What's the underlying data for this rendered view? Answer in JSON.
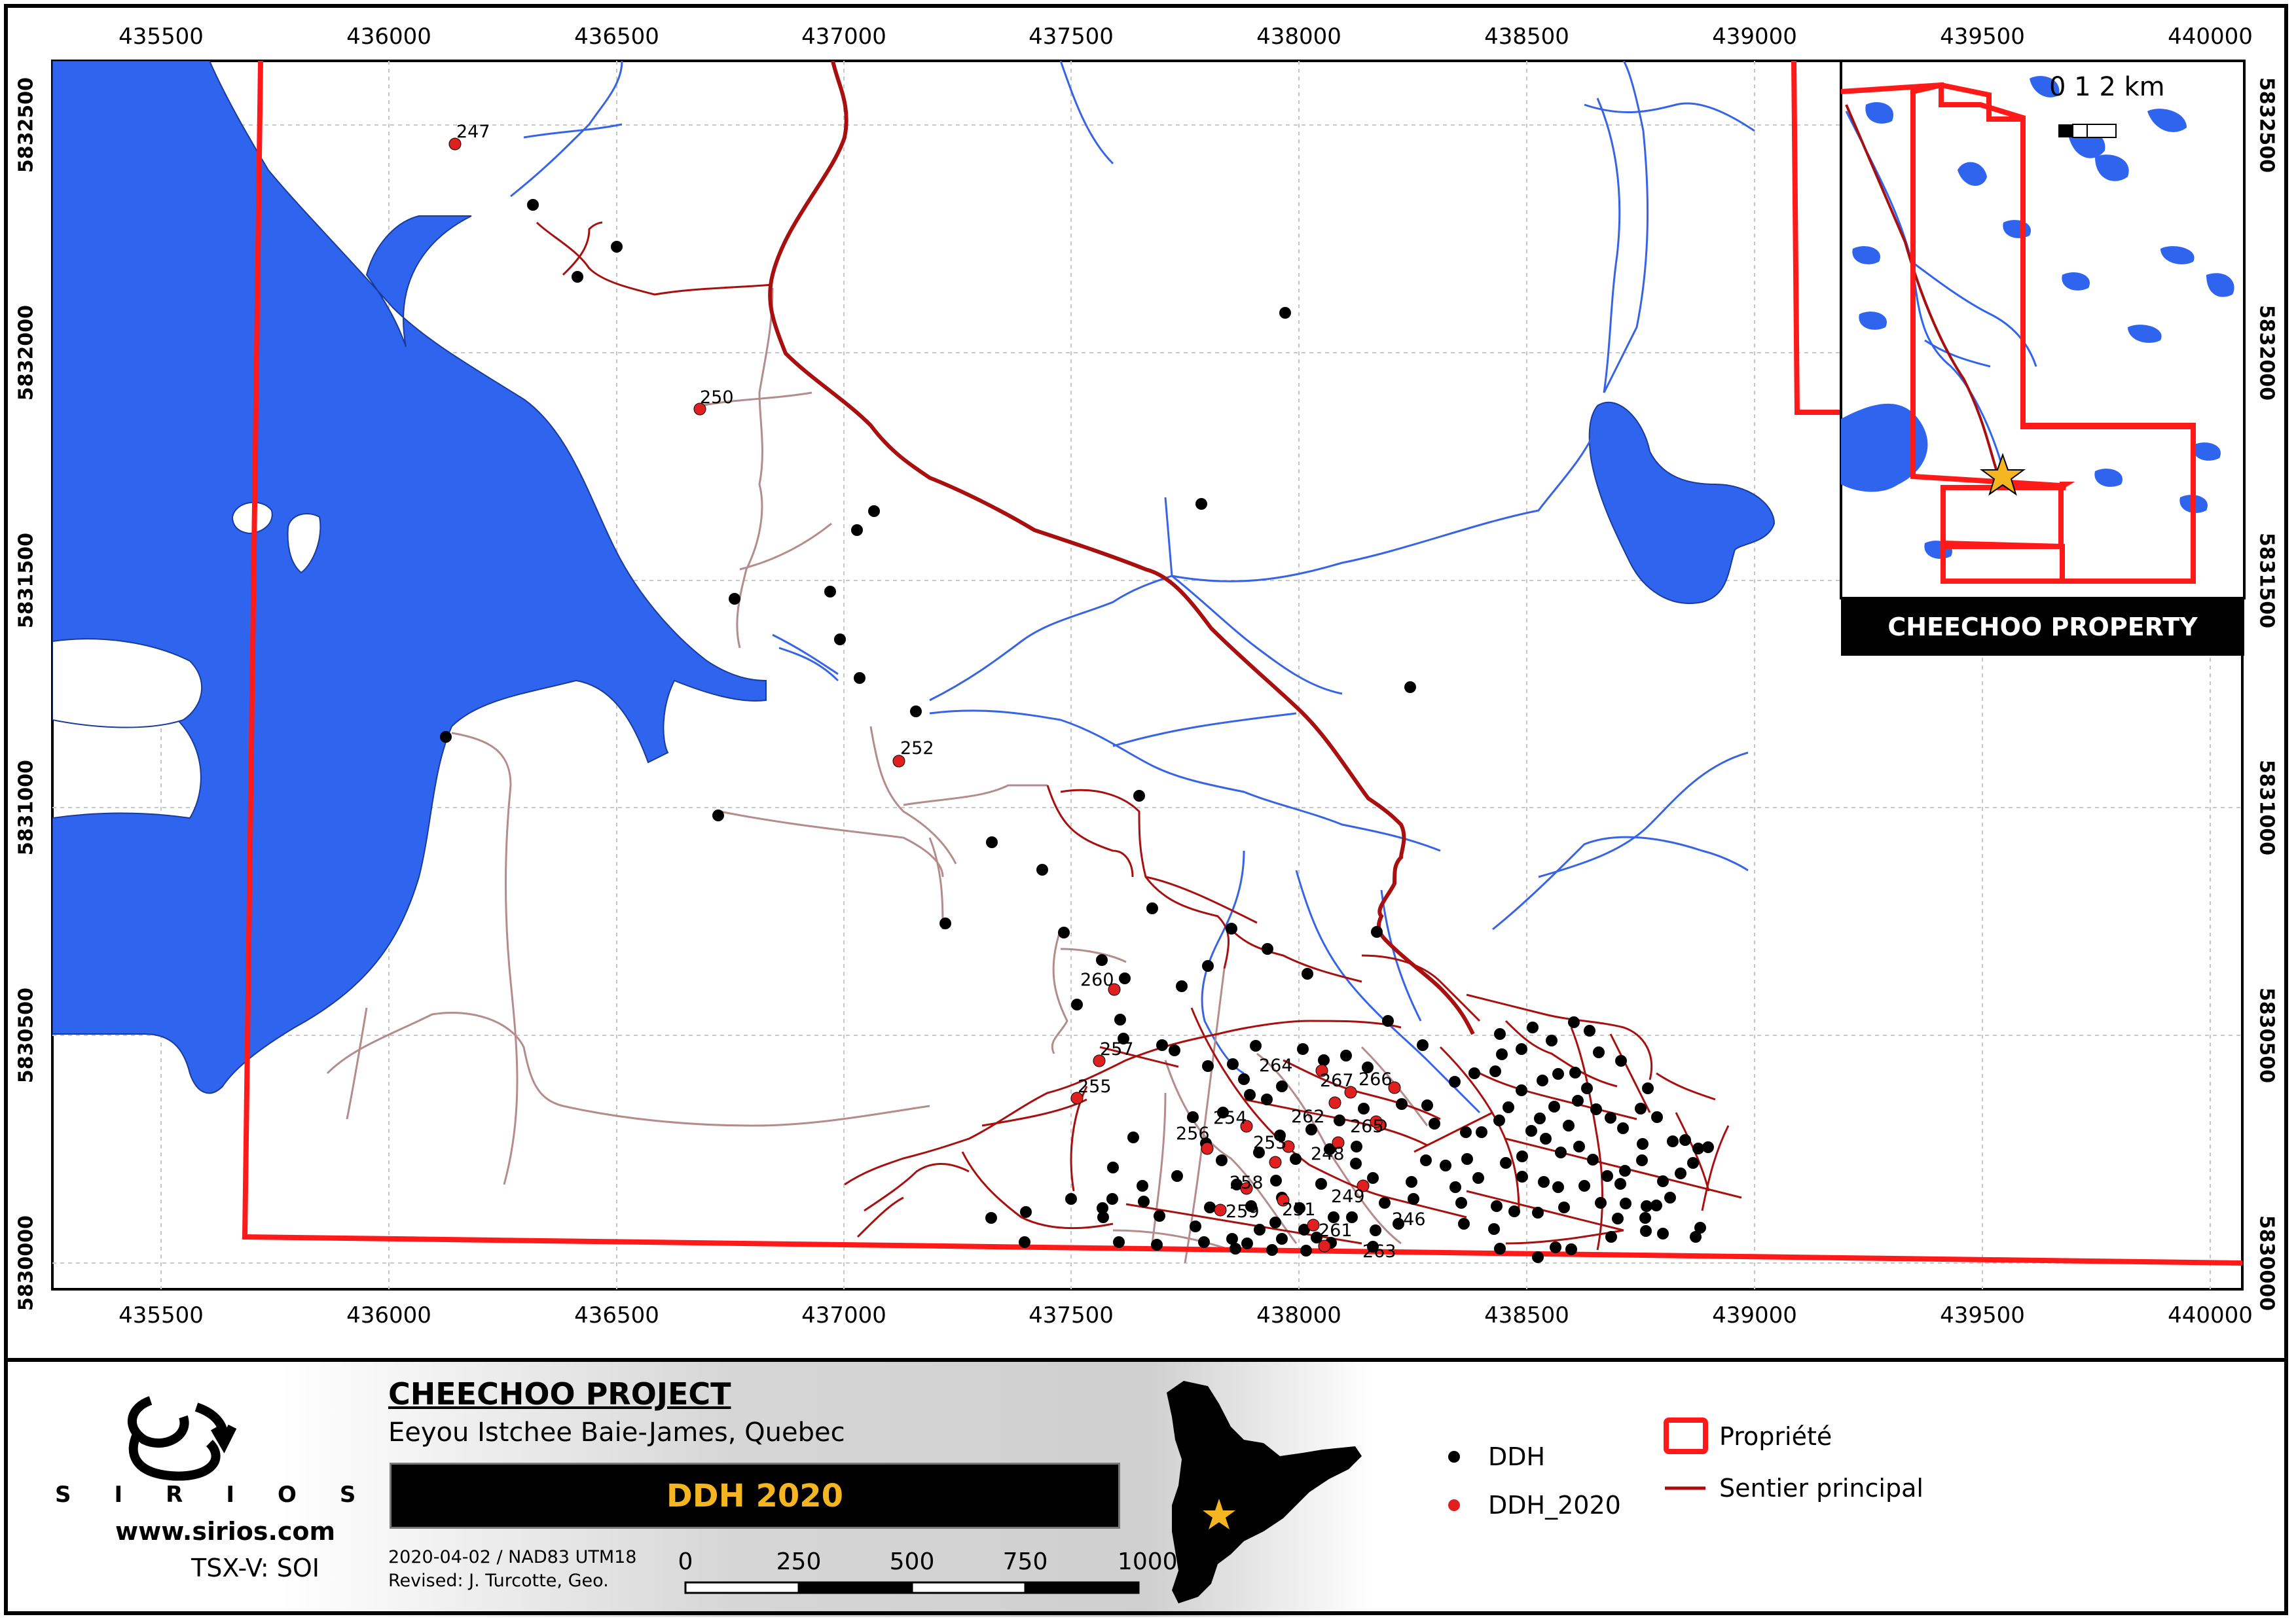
{
  "map": {
    "x_ticks": [
      "435500",
      "436000",
      "436500",
      "437000",
      "437500",
      "438000",
      "438500",
      "439000",
      "439500",
      "440000"
    ],
    "y_ticks": [
      "5832500",
      "5832000",
      "5831500",
      "5831000",
      "5830500",
      "5830000"
    ],
    "ddh_labels": [
      "247",
      "250",
      "252",
      "260",
      "257",
      "255",
      "254",
      "256",
      "253",
      "258",
      "259",
      "264",
      "262",
      "267",
      "266",
      "265",
      "248",
      "249",
      "251",
      "261",
      "246",
      "263"
    ],
    "colors": {
      "water": "#2e64ee",
      "property": "#ff1a1a",
      "main_trail": "#a80f0f",
      "trail": "#b48c8c",
      "stream": "#3764e6",
      "ddh": "#000000",
      "ddh_2020": "#e01f1f"
    }
  },
  "inset": {
    "scale_label": "0 1  2 km",
    "title": "CHEECHOO PROPERTY",
    "star_icon": "gold-star-icon"
  },
  "legend": {
    "project_title": "CHEECHOO PROJECT",
    "region": "Eeyou Istchee Baie-James, Quebec",
    "map_subtitle": "DDH 2020",
    "date_line": "2020-04-02 / NAD83 UTM18",
    "revised_line": "Revised: J. Turcotte, Geo.",
    "scale_labels": [
      "0",
      "250",
      "500",
      "750",
      "1000 m"
    ],
    "logo_text": "SIRIOS",
    "website": "www.sirios.com",
    "ticker": "TSX-V: SOI",
    "items": {
      "ddh": "DDH",
      "ddh_2020": "DDH_2020",
      "property": "Propriété",
      "main_trail": "Sentier principal"
    }
  }
}
